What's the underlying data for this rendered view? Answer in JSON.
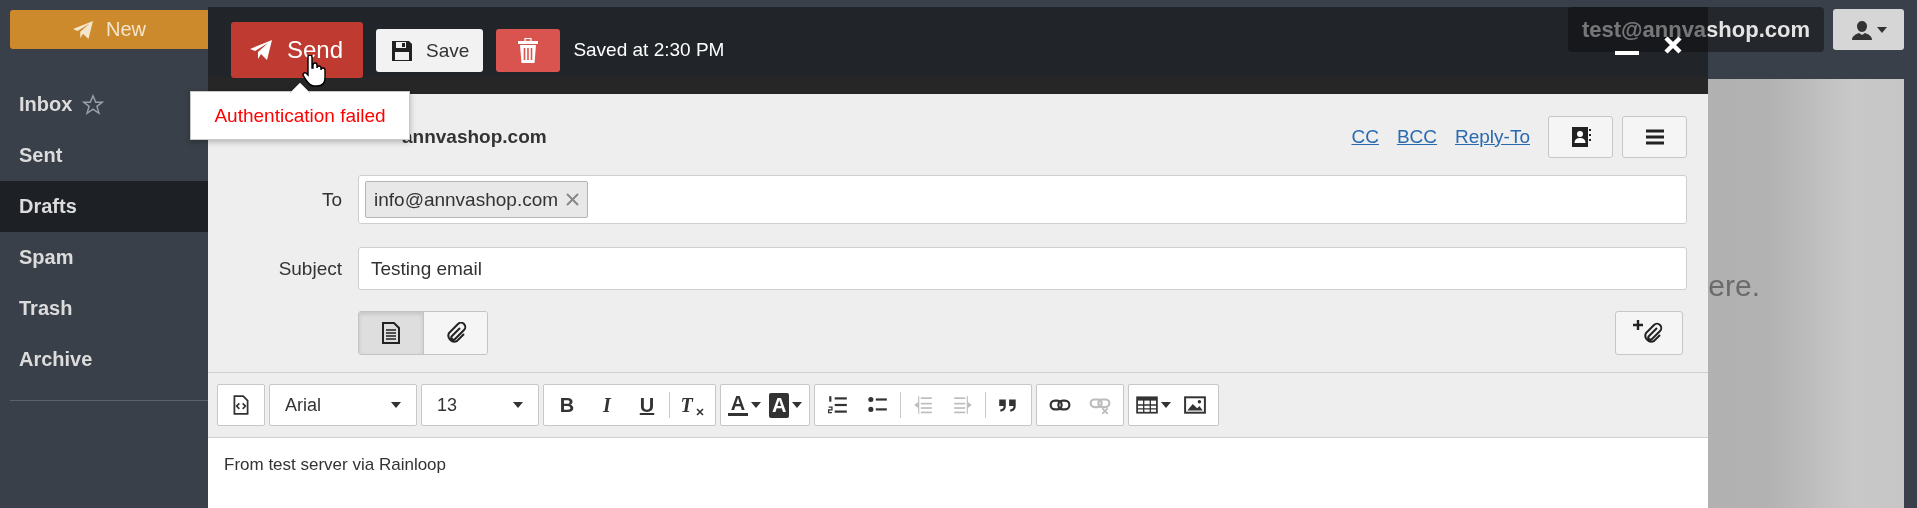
{
  "sidebar": {
    "new_button": {
      "label": "New"
    },
    "folders": [
      {
        "label": "Inbox",
        "selected": false,
        "star": true
      },
      {
        "label": "Sent",
        "selected": false,
        "star": false
      },
      {
        "label": "Drafts",
        "selected": true,
        "star": false
      },
      {
        "label": "Spam",
        "selected": false,
        "star": false
      },
      {
        "label": "Trash",
        "selected": false,
        "star": false
      },
      {
        "label": "Archive",
        "selected": false,
        "star": false
      }
    ]
  },
  "account": {
    "email": "test@annvashop.com"
  },
  "message_list": {
    "empty_text": "ere."
  },
  "compose": {
    "send": "Send",
    "save": "Save",
    "status": "Saved at 2:30 PM",
    "tooltip": "Authentication failed",
    "from": "annvashop.com",
    "header_links": [
      "CC",
      "BCC",
      "Reply-To"
    ],
    "to": {
      "label": "To",
      "recipients": [
        "info@annvashop.com"
      ]
    },
    "subject": {
      "label": "Subject",
      "value": "Testing email"
    },
    "modes": [
      {
        "kind": "text",
        "selected": true
      },
      {
        "kind": "attachments",
        "selected": false
      }
    ],
    "toolbar": {
      "groups": [
        {
          "sections": [
            {
              "items": [
                {
                  "kind": "source",
                  "disabled": false
                }
              ]
            }
          ]
        },
        {
          "sections": [
            {
              "items": [
                {
                  "kind": "font",
                  "value": "Arial",
                  "disabled": false
                }
              ]
            }
          ]
        },
        {
          "sections": [
            {
              "items": [
                {
                  "kind": "size",
                  "value": "13",
                  "disabled": false
                }
              ]
            }
          ]
        },
        {
          "sections": [
            {
              "items": [
                {
                  "kind": "bold",
                  "label": "B",
                  "disabled": false
                },
                {
                  "kind": "italic",
                  "label": "I",
                  "disabled": false
                },
                {
                  "kind": "underline",
                  "label": "U",
                  "disabled": false
                }
              ]
            },
            {
              "items": [
                {
                  "kind": "clear-format",
                  "label": "T",
                  "disabled": false
                }
              ]
            }
          ]
        },
        {
          "sections": [
            {
              "items": [
                {
                  "kind": "text-color",
                  "label": "A",
                  "disabled": false
                },
                {
                  "kind": "background-color",
                  "label": "A",
                  "disabled": false
                }
              ]
            }
          ]
        },
        {
          "sections": [
            {
              "items": [
                {
                  "kind": "numbered-list",
                  "disabled": false
                },
                {
                  "kind": "bullet-list",
                  "disabled": false
                }
              ]
            },
            {
              "items": [
                {
                  "kind": "outdent",
                  "disabled": true
                },
                {
                  "kind": "indent",
                  "disabled": true
                }
              ]
            },
            {
              "items": [
                {
                  "kind": "quote",
                  "disabled": false
                }
              ]
            }
          ]
        },
        {
          "sections": [
            {
              "items": [
                {
                  "kind": "link",
                  "disabled": false
                },
                {
                  "kind": "unlink",
                  "disabled": true
                }
              ]
            }
          ]
        },
        {
          "sections": [
            {
              "items": [
                {
                  "kind": "table",
                  "disabled": false
                },
                {
                  "kind": "image",
                  "disabled": false
                }
              ]
            }
          ]
        }
      ]
    },
    "body": "From test server via Rainloop"
  }
}
